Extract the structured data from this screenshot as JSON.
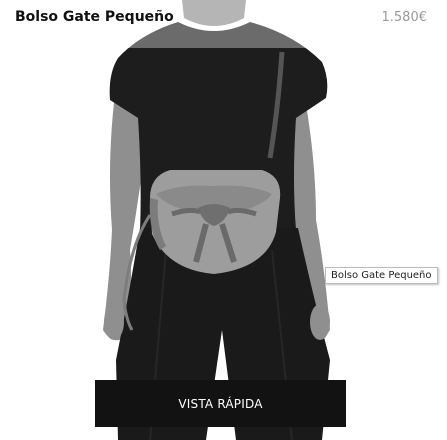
{
  "product": {
    "name": "Bolso Gate Pequeño",
    "price": "1.580€"
  },
  "tooltip": {
    "text": "Bolso Gate Pequeño"
  },
  "quick_view": {
    "label": "VISTA RÁPIDA"
  },
  "image": {
    "subject": "model-wearing-crossbody-bag",
    "palette": [
      "#ffffff",
      "#1c1c1c",
      "#8e8e8e",
      "#9c9c9c",
      "#6f6f6f"
    ]
  }
}
